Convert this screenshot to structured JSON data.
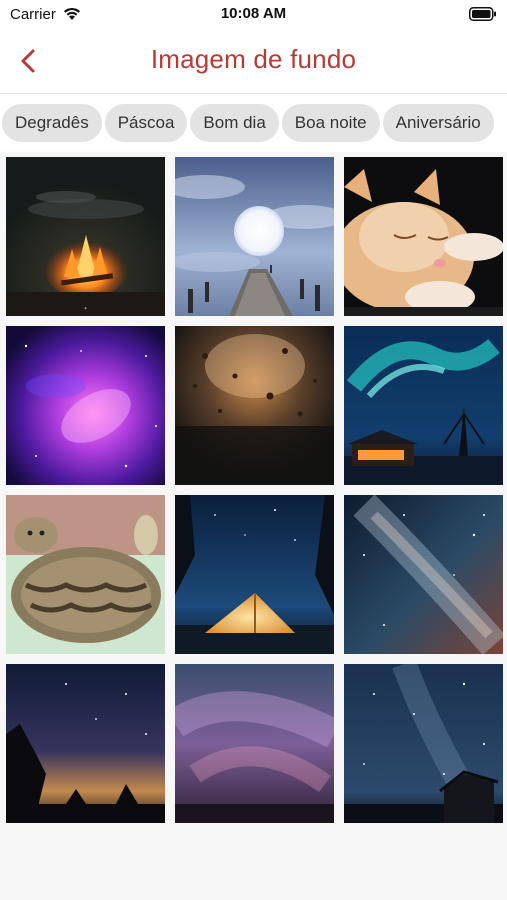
{
  "status_bar": {
    "carrier": "Carrier",
    "time": "10:08 AM",
    "wifi_icon": "wifi-icon",
    "battery_icon": "battery-icon"
  },
  "nav": {
    "title": "Imagem de fundo",
    "back_icon": "chevron-left-icon",
    "accent_color": "#b83a34"
  },
  "categories": [
    {
      "label": "Degradês"
    },
    {
      "label": "Páscoa"
    },
    {
      "label": "Bom dia"
    },
    {
      "label": "Boa noite"
    },
    {
      "label": "Aniversário"
    }
  ],
  "gallery": {
    "images": [
      {
        "subject": "campfire"
      },
      {
        "subject": "full-moon-pier"
      },
      {
        "subject": "sleeping-kitten"
      },
      {
        "subject": "purple-galaxy"
      },
      {
        "subject": "rain-drops-window"
      },
      {
        "subject": "aurora-cabin"
      },
      {
        "subject": "cat-on-blanket"
      },
      {
        "subject": "tent-under-stars"
      },
      {
        "subject": "milky-way"
      },
      {
        "subject": "starry-night-trees"
      },
      {
        "subject": "purple-aurora-sky"
      },
      {
        "subject": "starry-sky-barn"
      }
    ]
  }
}
